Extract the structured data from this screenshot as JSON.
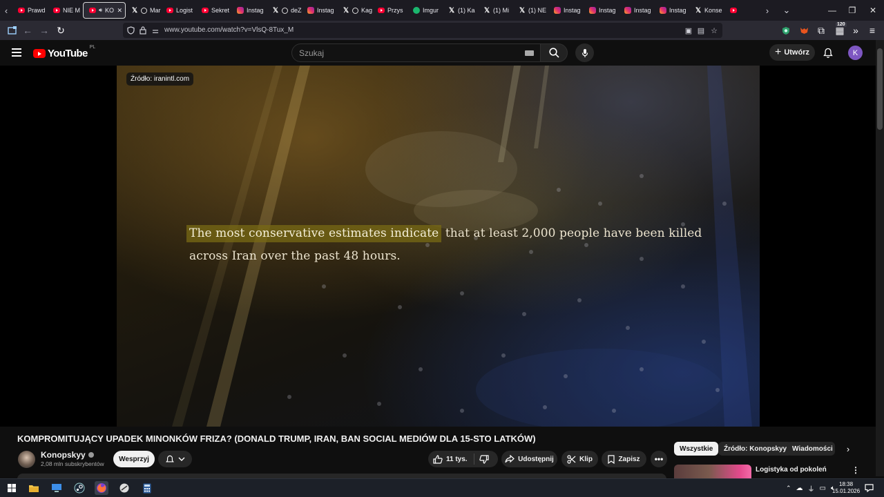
{
  "browser": {
    "tabs": [
      {
        "label": "Prawd",
        "icon": "youtube-icon",
        "kind": "yt"
      },
      {
        "label": "NIE M",
        "icon": "youtube-icon",
        "kind": "yt"
      },
      {
        "label": "KO",
        "icon": "youtube-icon",
        "kind": "yt",
        "active": true,
        "audio": true
      },
      {
        "label": "Marek",
        "icon": "x-icon",
        "kind": "x",
        "extra": "threads-icon"
      },
      {
        "label": "Logist",
        "icon": "youtube-icon",
        "kind": "yt"
      },
      {
        "label": "Sekret",
        "icon": "youtube-icon",
        "kind": "yt"
      },
      {
        "label": "Instag",
        "icon": "instagram-icon",
        "kind": "ig"
      },
      {
        "label": "deZeZ",
        "icon": "x-icon",
        "kind": "x",
        "extra": "threads-icon"
      },
      {
        "label": "Instag",
        "icon": "instagram-icon",
        "kind": "ig"
      },
      {
        "label": "Kaguy",
        "icon": "x-icon",
        "kind": "x",
        "extra": "threads-icon"
      },
      {
        "label": "Przys",
        "icon": "youtube-icon",
        "kind": "yt"
      },
      {
        "label": "Imgur",
        "icon": "imgur-icon",
        "kind": "imgur"
      },
      {
        "label": "(1) Ka",
        "icon": "x-icon",
        "kind": "x"
      },
      {
        "label": "(1) Mi",
        "icon": "x-icon",
        "kind": "x"
      },
      {
        "label": "(1) NE",
        "icon": "x-icon",
        "kind": "x"
      },
      {
        "label": "Instag",
        "icon": "instagram-icon",
        "kind": "ig"
      },
      {
        "label": "Instag",
        "icon": "instagram-icon",
        "kind": "ig"
      },
      {
        "label": "Instag",
        "icon": "instagram-icon",
        "kind": "ig"
      },
      {
        "label": "Instag",
        "icon": "instagram-icon",
        "kind": "ig"
      },
      {
        "label": "Konse",
        "icon": "x-icon",
        "kind": "x"
      },
      {
        "label": "",
        "icon": "youtube-icon",
        "kind": "yt"
      }
    ],
    "url": "www.youtube.com/watch?v=VlsQ-8Tux_M",
    "extensions_badge": "120"
  },
  "youtube": {
    "logo_text": "YouTube",
    "region": "PL",
    "search_placeholder": "Szukaj",
    "create_label": "Utwórz",
    "avatar_letter": "K"
  },
  "video": {
    "source_badge": "Źródło: iranintl.com",
    "caption_highlight": "The most conservative estimates indicate",
    "caption_rest": "that at least 2,000 people have been killed",
    "caption_line2": "across Iran over the past 48 hours.",
    "title": "KOMPROMITUJĄCY UPADEK MINONKÓW FRIZA? (DONALD TRUMP, IRAN, BAN SOCIAL MEDIÓW DLA 15-STO LATKÓW)"
  },
  "channel": {
    "name": "Konopskyy",
    "subscribers": "2,08 mln subskrybentów",
    "support_label": "Wesprzyj"
  },
  "actions": {
    "likes": "11 tys.",
    "share": "Udostępnij",
    "clip": "Klip",
    "save": "Zapisz"
  },
  "sidebar": {
    "chips": [
      "Wszystkie",
      "Źródło: Konopskyy",
      "Wiadomości z"
    ],
    "recommended_title": "Logistyka od pokoleń"
  },
  "taskbar": {
    "time": "18:38",
    "date": "15.01.2026"
  }
}
